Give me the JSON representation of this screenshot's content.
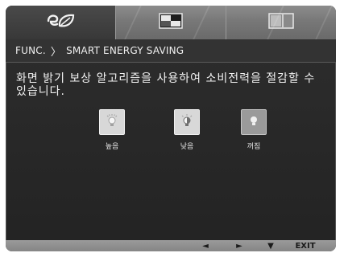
{
  "tabs": [
    {
      "icon": "eco-leaf-icon"
    },
    {
      "icon": "picture-icon"
    },
    {
      "icon": "layout-icon"
    }
  ],
  "header": {
    "func": "FUNC.",
    "separator": "〉",
    "title": "SMART ENERGY SAVING"
  },
  "description": "화면 밝기 보상 알고리즘을 사용하여 소비전력을 절감할 수 있습니다.",
  "options": [
    {
      "label": "높음",
      "icon": "bulb-high-icon",
      "style": "light"
    },
    {
      "label": "낮음",
      "icon": "bulb-low-icon",
      "style": "light"
    },
    {
      "label": "꺼짐",
      "icon": "bulb-off-icon",
      "style": "dark"
    }
  ],
  "bottom": {
    "left": "◄",
    "right": "►",
    "down": "▼",
    "exit": "EXIT"
  }
}
